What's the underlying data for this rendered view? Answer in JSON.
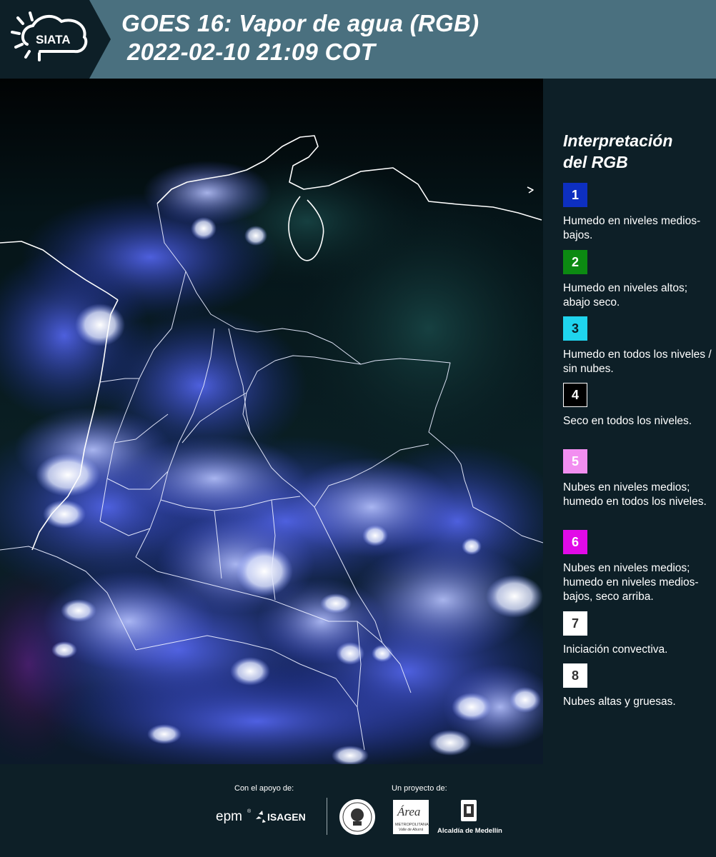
{
  "header": {
    "logo_text": "SIATA",
    "title_line1": "GOES 16: Vapor de agua (RGB)",
    "title_line2": "2022-02-10 21:09 COT"
  },
  "legend": {
    "title_line1": "Interpretación",
    "title_line2": "del RGB",
    "items": [
      {
        "number": "1",
        "color": "#0d2fc0",
        "text_color": "#ffffff",
        "text": "Humedo en niveles medios-bajos."
      },
      {
        "number": "2",
        "color": "#0c8a12",
        "text_color": "#ffffff",
        "text": "Humedo en niveles altos; abajo seco."
      },
      {
        "number": "3",
        "color": "#1fd4ee",
        "text_color": "#0d1f27",
        "text": "Humedo en todos los niveles / sin nubes."
      },
      {
        "number": "4",
        "color": "#000000",
        "text_color": "#ffffff",
        "text": "Seco en todos los niveles."
      },
      {
        "number": "5",
        "color": "#f28ef0",
        "text_color": "#ffffff",
        "text": "Nubes en niveles medios; humedo en todos los niveles."
      },
      {
        "number": "6",
        "color": "#e20ae8",
        "text_color": "#ffffff",
        "text": "Nubes en niveles medios; humedo en niveles medios-bajos, seco arriba."
      },
      {
        "number": "7",
        "color": "#ffffff",
        "text_color": "#333333",
        "text": "Iniciación convectiva."
      },
      {
        "number": "8",
        "color": "#ffffff",
        "text_color": "#333333",
        "text": "Nubes altas y gruesas."
      }
    ]
  },
  "footer": {
    "support_label": "Con el apoyo de:",
    "project_label": "Un proyecto de:",
    "logos": [
      "epm",
      "ISAGEN",
      "Área",
      "METROPOLITANA",
      "Valle de Aburrá",
      "Alcaldía de Medellín"
    ]
  },
  "colors": {
    "header_bg": "#4a707f",
    "dark_bg": "#0d1f27"
  }
}
